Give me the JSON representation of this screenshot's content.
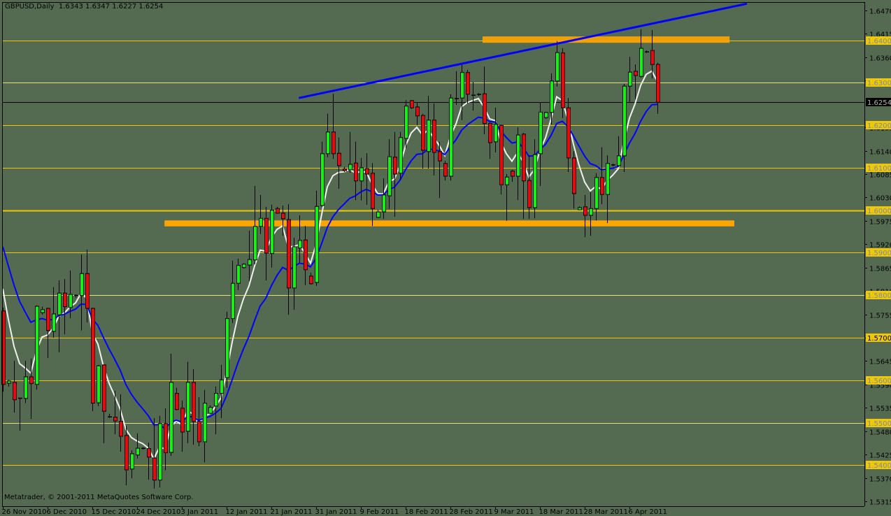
{
  "header": {
    "symbol": "GBPUSD,Daily",
    "ohlc_readout": "1.6343 1.6347 1.6227 1.6254"
  },
  "footer": {
    "copyright": "Metatrader, © 2001-2011 MetaQuotes Software Corp."
  },
  "colors": {
    "background": "#546b52",
    "bull": "#00ff00",
    "bear": "#ff0000",
    "level": "#f0c800",
    "level_light": "#e8dc7a",
    "zone": "#ffa500",
    "trendline": "#0000ff",
    "label_text": "#7a8aa0"
  },
  "chart_data": {
    "type": "candlestick",
    "symbol": "GBPUSD",
    "timeframe": "Daily",
    "ylim": [
      1.5315,
      1.647
    ],
    "price_axis_ticks": [
      "1.6470",
      "1.6415",
      "1.6360",
      "1.6305",
      "1.6195",
      "1.6140",
      "1.6085",
      "1.6030",
      "1.5975",
      "1.5920",
      "1.5865",
      "1.5810",
      "1.5755",
      "1.5700",
      "1.5645",
      "1.5590",
      "1.5535",
      "1.5480",
      "1.5425",
      "1.5370",
      "1.5315"
    ],
    "date_labels": [
      {
        "label": "26 Nov 2010",
        "index": 0
      },
      {
        "label": "6 Dec 2010",
        "index": 8
      },
      {
        "label": "15 Dec 2010",
        "index": 16
      },
      {
        "label": "24 Dec 2010",
        "index": 24
      },
      {
        "label": "3 Jan 2011",
        "index": 32
      },
      {
        "label": "12 Jan 2011",
        "index": 40
      },
      {
        "label": "21 Jan 2011",
        "index": 48
      },
      {
        "label": "31 Jan 2011",
        "index": 56
      },
      {
        "label": "9 Feb 2011",
        "index": 64
      },
      {
        "label": "18 Feb 2011",
        "index": 72
      },
      {
        "label": "28 Feb 2011",
        "index": 80
      },
      {
        "label": "9 Mar 2011",
        "index": 88
      },
      {
        "label": "18 Mar 2011",
        "index": 96
      },
      {
        "label": "28 Mar 2011",
        "index": 104
      },
      {
        "label": "6 Apr 2011",
        "index": 112
      }
    ],
    "current_price": {
      "value": 1.6254,
      "label": "1.6254"
    },
    "levels": [
      {
        "price": 1.64,
        "label": "1.6400",
        "style": "gold"
      },
      {
        "price": 1.63,
        "label": "1.6300",
        "style": "light"
      },
      {
        "price": 1.62,
        "label": "1.6200",
        "style": "gold"
      },
      {
        "price": 1.61,
        "label": "1.6100",
        "style": "gold"
      },
      {
        "price": 1.6,
        "label": "1.6000",
        "style": "gold-thick"
      },
      {
        "price": 1.59,
        "label": "1.5900",
        "style": "gold"
      },
      {
        "price": 1.58,
        "label": "1.5800",
        "style": "light"
      },
      {
        "price": 1.57,
        "label": "1.5700",
        "style": "gold",
        "dark_text": true
      },
      {
        "price": 1.56,
        "label": "1.5600",
        "style": "gold"
      },
      {
        "price": 1.55,
        "label": "1.5500",
        "style": "light"
      },
      {
        "price": 1.54,
        "label": "1.5400",
        "style": "gold"
      }
    ],
    "zones": [
      {
        "name": "resistance-zone",
        "from_index": 85.75,
        "to_index": 129.9,
        "price_top": 1.6409,
        "price_bottom": 1.6394
      },
      {
        "name": "support-zone",
        "from_index": 28.9,
        "to_index": 130.75,
        "price_top": 1.5976,
        "price_bottom": 1.5962
      }
    ],
    "trendline": {
      "from_index": 52.9,
      "from_price": 1.6264,
      "to_index": 133,
      "to_price": 1.6486
    },
    "indicators": [
      {
        "type": "EMA",
        "period": 5,
        "color": "#f0f0f0",
        "start": 1.5815
      },
      {
        "type": "EMA",
        "period": 13,
        "color": "#0000ff",
        "start": 1.5914
      }
    ],
    "ohlc": [
      [
        1.5763,
        1.5771,
        1.5573,
        1.559
      ],
      [
        1.5593,
        1.5601,
        1.5585,
        1.5598
      ],
      [
        1.5595,
        1.5646,
        1.5524,
        1.5554
      ],
      [
        1.5557,
        1.5559,
        1.5481,
        1.5558
      ],
      [
        1.5557,
        1.5646,
        1.5546,
        1.5608
      ],
      [
        1.5608,
        1.5651,
        1.5509,
        1.5592
      ],
      [
        1.559,
        1.5776,
        1.5578,
        1.5774
      ],
      [
        1.5759,
        1.5773,
        1.5754,
        1.5766
      ],
      [
        1.5769,
        1.5771,
        1.5652,
        1.5717
      ],
      [
        1.5715,
        1.5819,
        1.57,
        1.5756
      ],
      [
        1.5754,
        1.5835,
        1.5666,
        1.5805
      ],
      [
        1.5805,
        1.5838,
        1.5708,
        1.5773
      ],
      [
        1.5771,
        1.5858,
        1.5746,
        1.5802
      ],
      [
        1.5799,
        1.5802,
        1.5794,
        1.58
      ],
      [
        1.5799,
        1.5896,
        1.5717,
        1.5851
      ],
      [
        1.5851,
        1.5907,
        1.5736,
        1.5769
      ],
      [
        1.5769,
        1.5771,
        1.5527,
        1.5546
      ],
      [
        1.5547,
        1.5636,
        1.5539,
        1.5634
      ],
      [
        1.5636,
        1.5637,
        1.5452,
        1.5527
      ],
      [
        1.5514,
        1.5521,
        1.5511,
        1.5513
      ],
      [
        1.5513,
        1.5575,
        1.5473,
        1.5504
      ],
      [
        1.5503,
        1.5567,
        1.5432,
        1.5468
      ],
      [
        1.547,
        1.5493,
        1.5353,
        1.5389
      ],
      [
        1.5391,
        1.5435,
        1.5369,
        1.5427
      ],
      [
        1.5424,
        1.5475,
        1.5416,
        1.544
      ],
      [
        1.544,
        1.5442,
        1.5437,
        1.5439
      ],
      [
        1.5439,
        1.5453,
        1.5366,
        1.5419
      ],
      [
        1.5417,
        1.5511,
        1.5345,
        1.5365
      ],
      [
        1.5365,
        1.5516,
        1.5348,
        1.5498
      ],
      [
        1.5498,
        1.5534,
        1.5388,
        1.5429
      ],
      [
        1.543,
        1.5662,
        1.5422,
        1.5595
      ],
      [
        1.5569,
        1.5582,
        1.5529,
        1.5531
      ],
      [
        1.5534,
        1.5552,
        1.5432,
        1.5478
      ],
      [
        1.548,
        1.5643,
        1.5452,
        1.5595
      ],
      [
        1.5595,
        1.5626,
        1.5448,
        1.5503
      ],
      [
        1.5503,
        1.556,
        1.5445,
        1.5455
      ],
      [
        1.5455,
        1.5577,
        1.5407,
        1.5546
      ],
      [
        1.5522,
        1.5541,
        1.5521,
        1.5536
      ],
      [
        1.5539,
        1.5585,
        1.5473,
        1.5569
      ],
      [
        1.5569,
        1.5636,
        1.5511,
        1.5601
      ],
      [
        1.5606,
        1.5761,
        1.5582,
        1.5745
      ],
      [
        1.5745,
        1.5881,
        1.5735,
        1.5828
      ],
      [
        1.5828,
        1.5886,
        1.5812,
        1.587
      ],
      [
        1.5865,
        1.5875,
        1.5863,
        1.5873
      ],
      [
        1.5871,
        1.5952,
        1.5833,
        1.5884
      ],
      [
        1.5883,
        1.6057,
        1.5873,
        1.5962
      ],
      [
        1.5962,
        1.6036,
        1.5944,
        1.5981
      ],
      [
        1.5981,
        1.6008,
        1.5835,
        1.5899
      ],
      [
        1.5898,
        1.6013,
        1.5865,
        1.6
      ],
      [
        1.6004,
        1.6008,
        1.5992,
        1.5993
      ],
      [
        1.5993,
        1.6011,
        1.594,
        1.598
      ],
      [
        1.5978,
        1.6014,
        1.5754,
        1.5817
      ],
      [
        1.5817,
        1.5935,
        1.5766,
        1.5914
      ],
      [
        1.5911,
        1.5988,
        1.5876,
        1.5929
      ],
      [
        1.593,
        1.5963,
        1.5824,
        1.586
      ],
      [
        1.5845,
        1.5853,
        1.5825,
        1.5827
      ],
      [
        1.583,
        1.6046,
        1.5822,
        1.6009
      ],
      [
        1.6011,
        1.6161,
        1.6008,
        1.6133
      ],
      [
        1.6133,
        1.6227,
        1.6125,
        1.6184
      ],
      [
        1.6184,
        1.6274,
        1.6121,
        1.6133
      ],
      [
        1.6134,
        1.6171,
        1.6051,
        1.6105
      ],
      [
        1.6097,
        1.6102,
        1.609,
        1.6093
      ],
      [
        1.6095,
        1.6184,
        1.6088,
        1.6108
      ],
      [
        1.6111,
        1.6161,
        1.6024,
        1.6069
      ],
      [
        1.6069,
        1.6123,
        1.6023,
        1.61
      ],
      [
        1.6098,
        1.6134,
        1.6013,
        1.6085
      ],
      [
        1.6087,
        1.6111,
        1.5963,
        1.6004
      ],
      [
        1.5983,
        1.6001,
        1.5982,
        1.5996
      ],
      [
        1.5996,
        1.6075,
        1.598,
        1.6036
      ],
      [
        1.6034,
        1.6167,
        1.6003,
        1.6126
      ],
      [
        1.6125,
        1.6184,
        1.5985,
        1.6085
      ],
      [
        1.6087,
        1.6184,
        1.6072,
        1.6171
      ],
      [
        1.6169,
        1.6259,
        1.6146,
        1.6245
      ],
      [
        1.6258,
        1.6259,
        1.6238,
        1.6241
      ],
      [
        1.6243,
        1.6255,
        1.62,
        1.6222
      ],
      [
        1.6223,
        1.6227,
        1.6098,
        1.6141
      ],
      [
        1.6138,
        1.6269,
        1.6098,
        1.6212
      ],
      [
        1.6212,
        1.6251,
        1.6082,
        1.6136
      ],
      [
        1.6138,
        1.6161,
        1.6029,
        1.6116
      ],
      [
        1.611,
        1.6116,
        1.607,
        1.608
      ],
      [
        1.608,
        1.6273,
        1.607,
        1.6264
      ],
      [
        1.6263,
        1.6327,
        1.6248,
        1.6262
      ],
      [
        1.6264,
        1.6343,
        1.6212,
        1.6324
      ],
      [
        1.6324,
        1.633,
        1.6251,
        1.6273
      ],
      [
        1.6271,
        1.6302,
        1.6235,
        1.6268
      ],
      [
        1.6273,
        1.6276,
        1.6269,
        1.6272
      ],
      [
        1.6274,
        1.6338,
        1.6179,
        1.6204
      ],
      [
        1.6204,
        1.6207,
        1.6121,
        1.6159
      ],
      [
        1.6161,
        1.6241,
        1.6136,
        1.6202
      ],
      [
        1.62,
        1.6201,
        1.6037,
        1.606
      ],
      [
        1.606,
        1.6085,
        1.5975,
        1.6078
      ],
      [
        1.6092,
        1.6095,
        1.6067,
        1.608
      ],
      [
        1.608,
        1.6195,
        1.6024,
        1.6177
      ],
      [
        1.6179,
        1.6182,
        1.598,
        1.6069
      ],
      [
        1.607,
        1.6129,
        1.598,
        1.6006
      ],
      [
        1.6006,
        1.6167,
        1.5981,
        1.6131
      ],
      [
        1.6133,
        1.6253,
        1.6057,
        1.6231
      ],
      [
        1.6218,
        1.6232,
        1.6215,
        1.623
      ],
      [
        1.623,
        1.6322,
        1.6202,
        1.6304
      ],
      [
        1.6304,
        1.6398,
        1.6291,
        1.6371
      ],
      [
        1.637,
        1.6381,
        1.6217,
        1.6241
      ],
      [
        1.6241,
        1.6264,
        1.609,
        1.6123
      ],
      [
        1.6123,
        1.6139,
        1.6004,
        1.6039
      ],
      [
        1.6001,
        1.6009,
        1.6,
        1.6006
      ],
      [
        1.6008,
        1.6036,
        1.5937,
        1.5988
      ],
      [
        1.5988,
        1.6042,
        1.594,
        1.6004
      ],
      [
        1.6004,
        1.6087,
        1.5976,
        1.6077
      ],
      [
        1.6077,
        1.6148,
        1.6014,
        1.6037
      ],
      [
        1.6037,
        1.6129,
        1.597,
        1.611
      ],
      [
        1.6106,
        1.611,
        1.6103,
        1.6107
      ],
      [
        1.6105,
        1.6174,
        1.6102,
        1.6128
      ],
      [
        1.6128,
        1.6297,
        1.609,
        1.6292
      ],
      [
        1.6292,
        1.6361,
        1.6255,
        1.6325
      ],
      [
        1.6327,
        1.6343,
        1.6261,
        1.6317
      ],
      [
        1.6315,
        1.6426,
        1.6312,
        1.6381
      ],
      [
        1.6373,
        1.6376,
        1.637,
        1.6372
      ],
      [
        1.6376,
        1.6424,
        1.631,
        1.6343
      ],
      [
        1.6343,
        1.6347,
        1.6227,
        1.6254
      ]
    ]
  }
}
